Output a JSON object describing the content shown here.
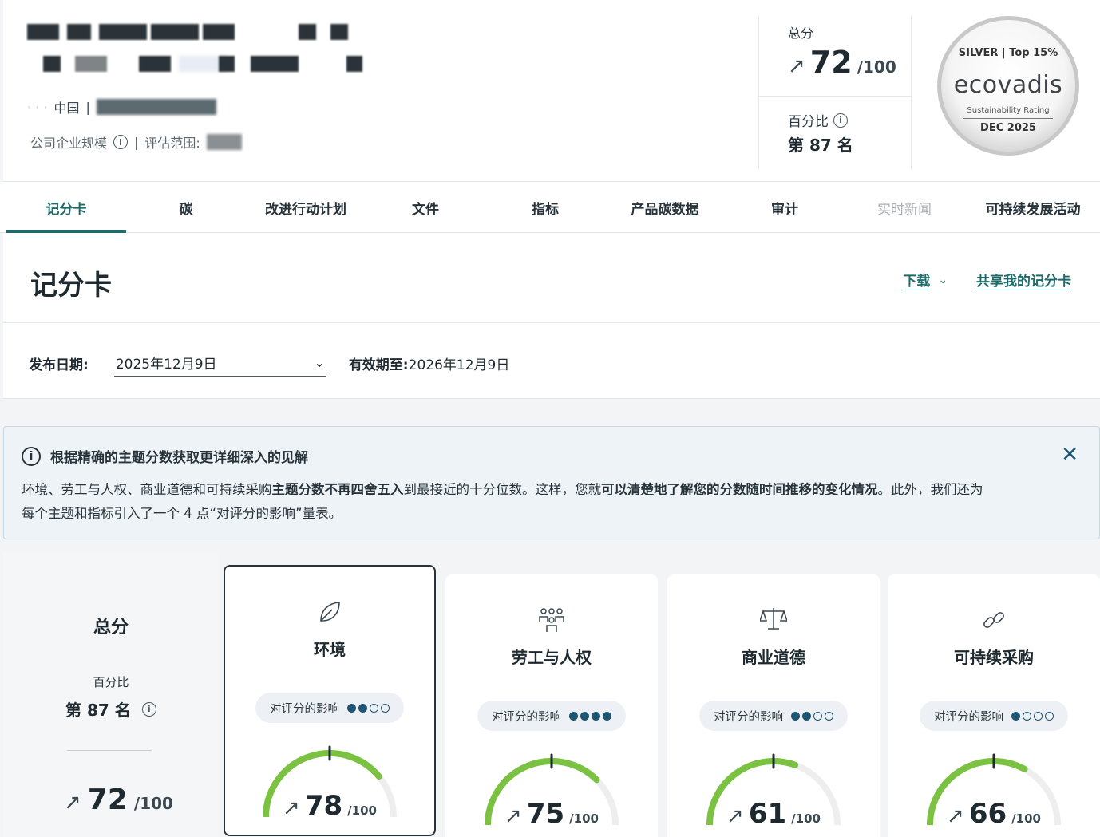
{
  "header": {
    "country": "中国",
    "company_size_label": "公司企业规模",
    "scope_label": "评估范围:",
    "total_score_label": "总分",
    "total_score": "72",
    "total_denominator": "/100",
    "percentile_label": "百分比",
    "rank": "第 87 名"
  },
  "medal": {
    "level": "SILVER | Top 15%",
    "brand": "ecovadis",
    "subtitle": "Sustainability Rating",
    "date": "DEC 2025"
  },
  "tabs": [
    {
      "label": "记分卡",
      "active": true
    },
    {
      "label": "碳"
    },
    {
      "label": "改进行动计划"
    },
    {
      "label": "文件"
    },
    {
      "label": "指标"
    },
    {
      "label": "产品碳数据"
    },
    {
      "label": "审计"
    },
    {
      "label": "实时新闻",
      "disabled": true
    },
    {
      "label": "可持续发展活动"
    }
  ],
  "scorecard": {
    "title": "记分卡",
    "download_label": "下载",
    "share_label": "共享我的记分卡",
    "publish_date_label": "发布日期:",
    "publish_date_value": "2025年12月9日",
    "valid_until_label": "有效期至:",
    "valid_until_value": "2026年12月9日"
  },
  "banner": {
    "title": "根据精确的主题分数获取更详细深入的见解",
    "text_1": "环境、劳工与人权、商业道德和可持续采购",
    "text_2_bold": "主题分数不再四舍五入",
    "text_3": "到最接近的十分位数。这样，您就",
    "text_4_bold": "可以清楚地了解您的分数随时间推移的变化情况",
    "text_5": "。此外，我们还为每个主题和指标引入了一个 4 点“对评分的影响”量表。"
  },
  "overall": {
    "title": "总分",
    "percentile_label": "百分比",
    "rank": "第 87 名",
    "score": "72",
    "denominator": "/100"
  },
  "themes": [
    {
      "name": "环境",
      "icon": "leaf-icon",
      "impact_label": "对评分的影响",
      "impact_level": 2,
      "score": "78",
      "value": 78,
      "denominator": "/100"
    },
    {
      "name": "劳工与人权",
      "icon": "people-icon",
      "impact_label": "对评分的影响",
      "impact_level": 4,
      "score": "75",
      "value": 75,
      "denominator": "/100"
    },
    {
      "name": "商业道德",
      "icon": "scales-icon",
      "impact_label": "对评分的影响",
      "impact_level": 2,
      "score": "61",
      "value": 61,
      "denominator": "/100"
    },
    {
      "name": "可持续采购",
      "icon": "link-icon",
      "impact_label": "对评分的影响",
      "impact_level": 1,
      "score": "66",
      "value": 66,
      "denominator": "/100"
    }
  ],
  "colors": {
    "accent": "#1d6b6a",
    "gauge_fill": "#7cc242",
    "gauge_track": "#eeeeee",
    "impact_dot": "#1d5673"
  }
}
